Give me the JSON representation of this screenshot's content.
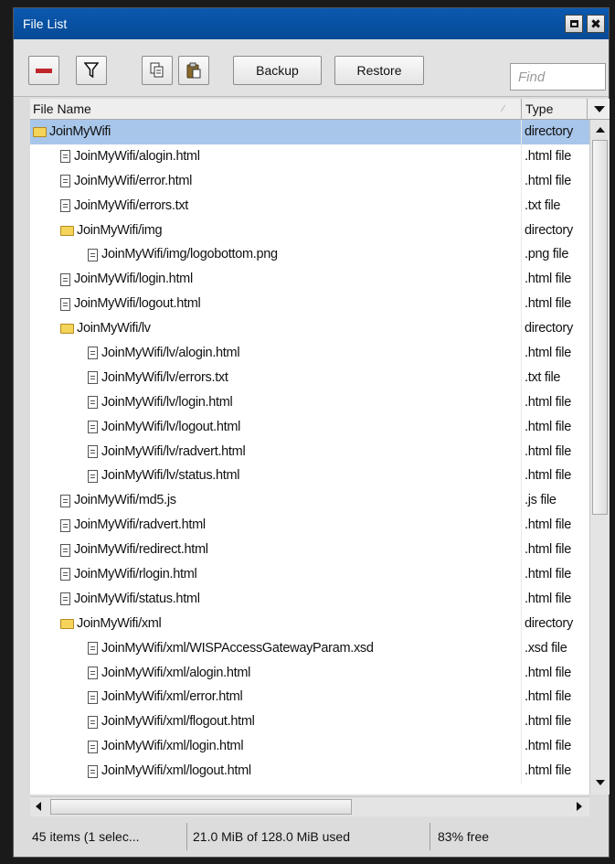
{
  "window": {
    "title": "File List",
    "restore_icon": "restore-icon",
    "close_glyph": "✖"
  },
  "toolbar": {
    "remove_icon": "minus-icon",
    "filter_icon": "filter-icon",
    "copy_icon": "copy-icon",
    "paste_icon": "paste-icon",
    "backup_label": "Backup",
    "restore_label": "Restore",
    "find_placeholder": "Find"
  },
  "columns": {
    "name": "File Name",
    "type": "Type"
  },
  "files": [
    {
      "indent": 0,
      "kind": "folder",
      "name": "JoinMyWifi",
      "type": "directory",
      "selected": true
    },
    {
      "indent": 1,
      "kind": "file",
      "name": "JoinMyWifi/alogin.html",
      "type": ".html file"
    },
    {
      "indent": 1,
      "kind": "file",
      "name": "JoinMyWifi/error.html",
      "type": ".html file"
    },
    {
      "indent": 1,
      "kind": "file",
      "name": "JoinMyWifi/errors.txt",
      "type": ".txt file"
    },
    {
      "indent": 1,
      "kind": "folder",
      "name": "JoinMyWifi/img",
      "type": "directory"
    },
    {
      "indent": 2,
      "kind": "file",
      "name": "JoinMyWifi/img/logobottom.png",
      "type": ".png file"
    },
    {
      "indent": 1,
      "kind": "file",
      "name": "JoinMyWifi/login.html",
      "type": ".html file"
    },
    {
      "indent": 1,
      "kind": "file",
      "name": "JoinMyWifi/logout.html",
      "type": ".html file"
    },
    {
      "indent": 1,
      "kind": "folder",
      "name": "JoinMyWifi/lv",
      "type": "directory"
    },
    {
      "indent": 2,
      "kind": "file",
      "name": "JoinMyWifi/lv/alogin.html",
      "type": ".html file"
    },
    {
      "indent": 2,
      "kind": "file",
      "name": "JoinMyWifi/lv/errors.txt",
      "type": ".txt file"
    },
    {
      "indent": 2,
      "kind": "file",
      "name": "JoinMyWifi/lv/login.html",
      "type": ".html file"
    },
    {
      "indent": 2,
      "kind": "file",
      "name": "JoinMyWifi/lv/logout.html",
      "type": ".html file"
    },
    {
      "indent": 2,
      "kind": "file",
      "name": "JoinMyWifi/lv/radvert.html",
      "type": ".html file"
    },
    {
      "indent": 2,
      "kind": "file",
      "name": "JoinMyWifi/lv/status.html",
      "type": ".html file"
    },
    {
      "indent": 1,
      "kind": "file",
      "name": "JoinMyWifi/md5.js",
      "type": ".js file"
    },
    {
      "indent": 1,
      "kind": "file",
      "name": "JoinMyWifi/radvert.html",
      "type": ".html file"
    },
    {
      "indent": 1,
      "kind": "file",
      "name": "JoinMyWifi/redirect.html",
      "type": ".html file"
    },
    {
      "indent": 1,
      "kind": "file",
      "name": "JoinMyWifi/rlogin.html",
      "type": ".html file"
    },
    {
      "indent": 1,
      "kind": "file",
      "name": "JoinMyWifi/status.html",
      "type": ".html file"
    },
    {
      "indent": 1,
      "kind": "folder",
      "name": "JoinMyWifi/xml",
      "type": "directory"
    },
    {
      "indent": 2,
      "kind": "file",
      "name": "JoinMyWifi/xml/WISPAccessGatewayParam.xsd",
      "type": ".xsd file"
    },
    {
      "indent": 2,
      "kind": "file",
      "name": "JoinMyWifi/xml/alogin.html",
      "type": ".html file"
    },
    {
      "indent": 2,
      "kind": "file",
      "name": "JoinMyWifi/xml/error.html",
      "type": ".html file"
    },
    {
      "indent": 2,
      "kind": "file",
      "name": "JoinMyWifi/xml/flogout.html",
      "type": ".html file"
    },
    {
      "indent": 2,
      "kind": "file",
      "name": "JoinMyWifi/xml/login.html",
      "type": ".html file"
    },
    {
      "indent": 2,
      "kind": "file",
      "name": "JoinMyWifi/xml/logout.html",
      "type": ".html file"
    }
  ],
  "status": {
    "items": "45 items (1 selec...",
    "usage": "21.0 MiB of 128.0 MiB used",
    "free": "83% free"
  },
  "colors": {
    "titlebar": "#0b59b0",
    "selection": "#a8c6ea",
    "remove": "#c0262a",
    "folder": "#f4d45a"
  }
}
